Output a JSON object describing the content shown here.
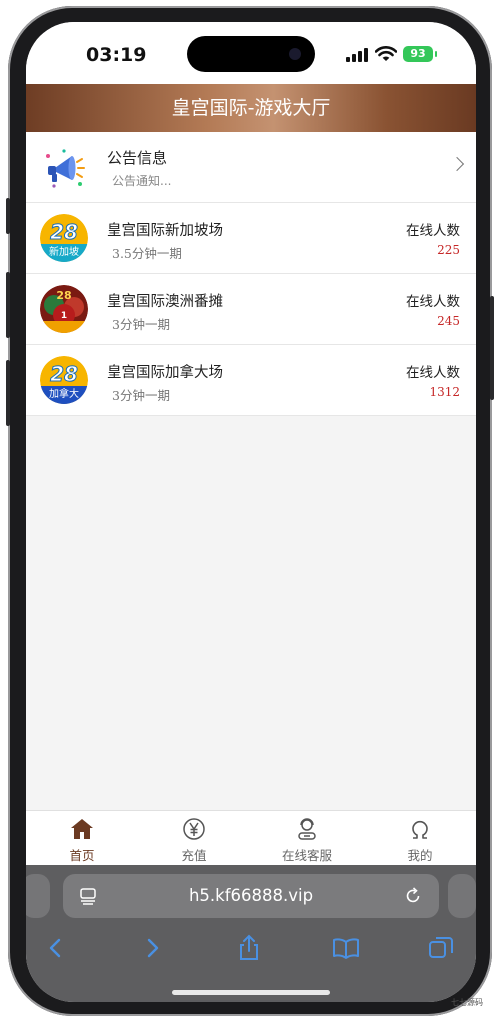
{
  "status_bar": {
    "time": "03:19",
    "battery": "93"
  },
  "header": {
    "title": "皇宫国际-游戏大厅"
  },
  "notice": {
    "title": "公告信息",
    "subtitle": "公告通知..."
  },
  "games": [
    {
      "name": "皇宫国际新加坡场",
      "period": "3.5分钟一期",
      "online_label": "在线人数",
      "online_count": "225",
      "logo_number": "28",
      "logo_badge": "新加坡"
    },
    {
      "name": "皇宫国际澳洲番摊",
      "period": "3分钟一期",
      "online_label": "在线人数",
      "online_count": "245",
      "logo_number": "28",
      "logo_badge": "1"
    },
    {
      "name": "皇宫国际加拿大场",
      "period": "3分钟一期",
      "online_label": "在线人数",
      "online_count": "1312",
      "logo_number": "28",
      "logo_badge": "加拿大"
    }
  ],
  "tabs": [
    {
      "label": "首页",
      "icon": "home-icon",
      "active": true
    },
    {
      "label": "充值",
      "icon": "yen-icon",
      "active": false
    },
    {
      "label": "在线客服",
      "icon": "support-agent-icon",
      "active": false
    },
    {
      "label": "我的",
      "icon": "profile-icon",
      "active": false
    }
  ],
  "browser": {
    "url": "h5.kf66888.vip"
  },
  "watermark": "七七源码",
  "colors": {
    "header_brown": "#8a5333",
    "active_tab": "#6b3a22",
    "count_red": "#c62828",
    "battery_green": "#34c759"
  }
}
